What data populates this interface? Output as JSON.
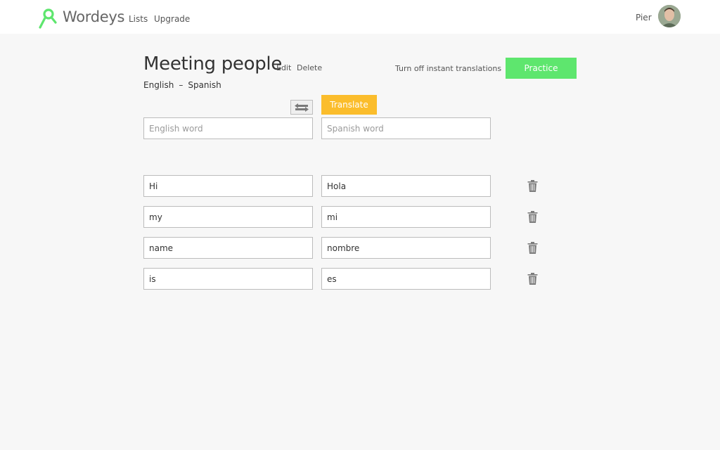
{
  "header": {
    "brand": "Wordeys",
    "nav": {
      "lists": "Lists",
      "upgrade": "Upgrade"
    },
    "user": {
      "name": "Pier"
    },
    "accent": "#5ee66e"
  },
  "list": {
    "title": "Meeting people",
    "edit_label": "Edit",
    "delete_label": "Delete",
    "source_language": "English",
    "separator": "–",
    "target_language": "Spanish"
  },
  "toolbar": {
    "instant_translations_label": "Turn off instant translations",
    "practice_label": "Practice",
    "translate_label": "Translate",
    "practice_color": "#5ee66e",
    "translate_color": "#fbbd2c"
  },
  "new_entry": {
    "source_placeholder": "English word",
    "target_placeholder": "Spanish word",
    "source_value": "",
    "target_value": ""
  },
  "entries": [
    {
      "source": "Hi",
      "target": "Hola"
    },
    {
      "source": "my",
      "target": "mi"
    },
    {
      "source": "name",
      "target": "nombre"
    },
    {
      "source": "is",
      "target": "es"
    }
  ]
}
